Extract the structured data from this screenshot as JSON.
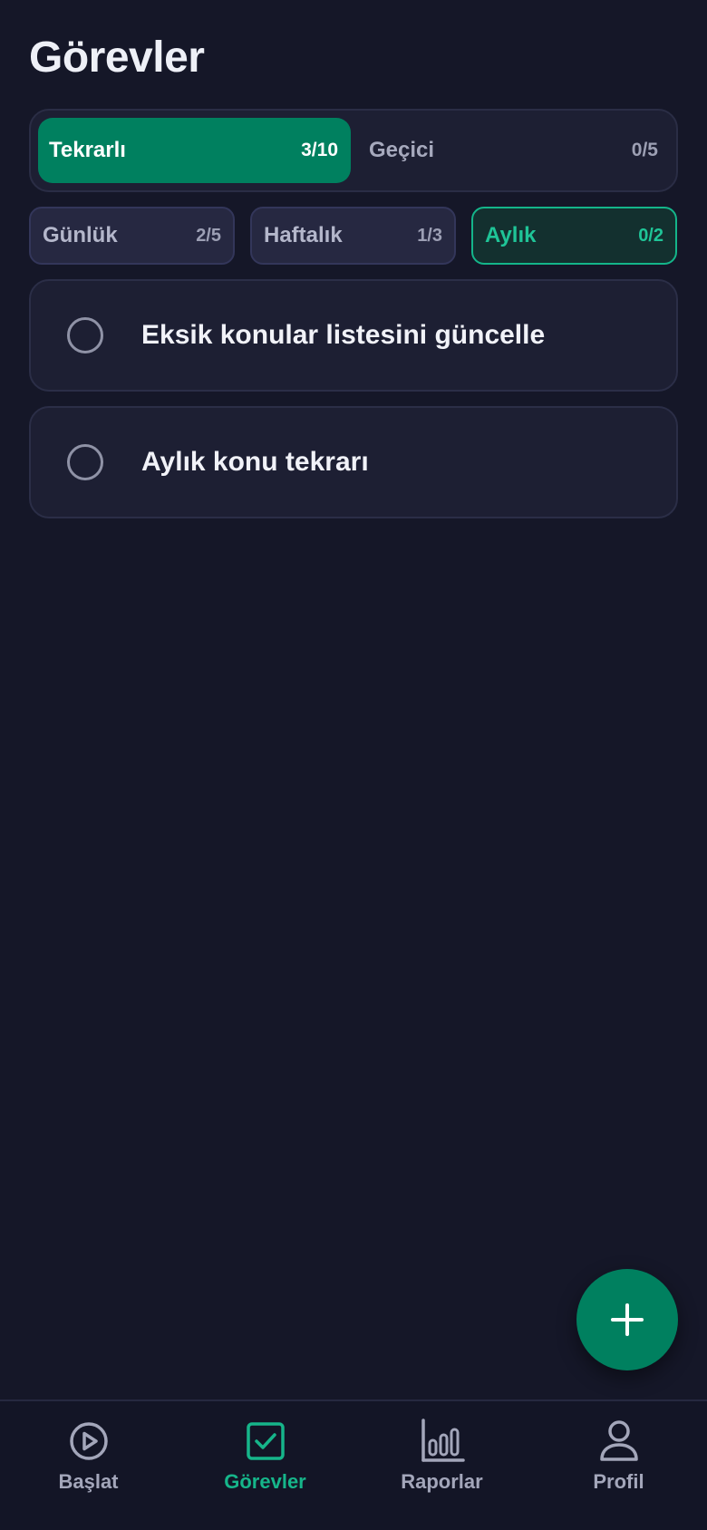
{
  "header": {
    "title": "Görevler"
  },
  "segments": [
    {
      "label": "Tekrarlı",
      "count": "3/10",
      "active": true
    },
    {
      "label": "Geçici",
      "count": "0/5",
      "active": false
    }
  ],
  "filters": [
    {
      "label": "Günlük",
      "count": "2/5",
      "active": false
    },
    {
      "label": "Haftalık",
      "count": "1/3",
      "active": false
    },
    {
      "label": "Aylık",
      "count": "0/2",
      "active": true
    }
  ],
  "tasks": [
    {
      "title": "Eksik konular listesini güncelle",
      "done": false
    },
    {
      "title": "Aylık konu tekrarı",
      "done": false
    }
  ],
  "fab": {
    "icon": "plus-icon"
  },
  "nav": [
    {
      "label": "Başlat",
      "icon": "play-circle-icon",
      "active": false
    },
    {
      "label": "Görevler",
      "icon": "checkbox-icon",
      "active": true
    },
    {
      "label": "Raporlar",
      "icon": "bar-chart-icon",
      "active": false
    },
    {
      "label": "Profil",
      "icon": "user-icon",
      "active": false
    }
  ],
  "colors": {
    "background": "#151728",
    "accent": "#00805f",
    "accent_text": "#16b58a",
    "card": "#1d1f33"
  }
}
